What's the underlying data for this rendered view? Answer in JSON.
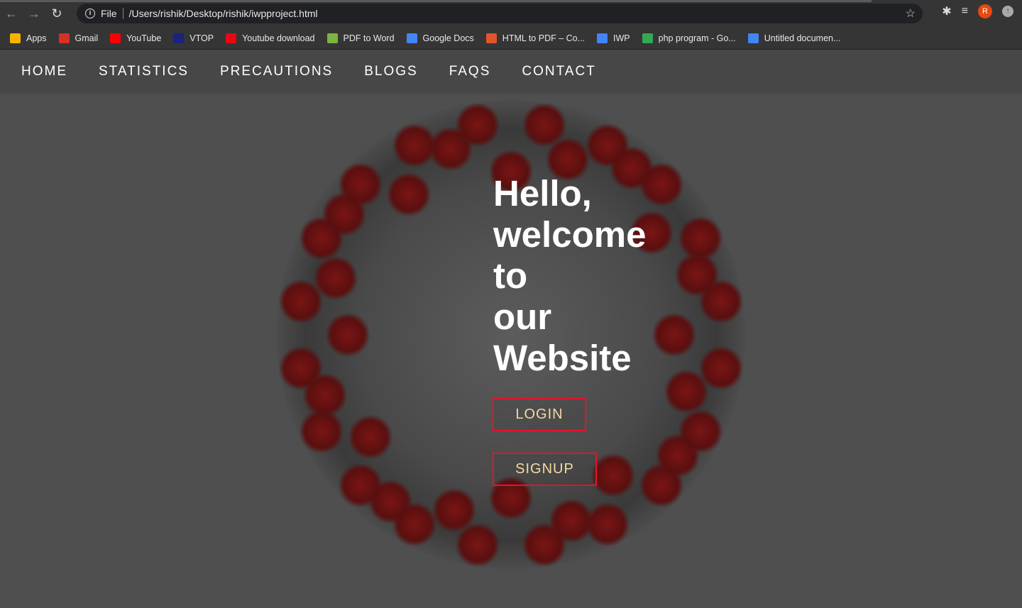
{
  "browser": {
    "url_scheme": "File",
    "url": "/Users/rishik/Desktop/rishik/iwpproject.html",
    "profile_initial": "R",
    "bookmarks": [
      {
        "label": "Apps",
        "color": "#f4b400"
      },
      {
        "label": "Gmail",
        "color": "#d93025"
      },
      {
        "label": "YouTube",
        "color": "#ff0000"
      },
      {
        "label": "VTOP",
        "color": "#1a237e"
      },
      {
        "label": "Youtube download",
        "color": "#e50914"
      },
      {
        "label": "PDF to Word",
        "color": "#7cb342"
      },
      {
        "label": "Google Docs",
        "color": "#4285f4"
      },
      {
        "label": "HTML to PDF – Co...",
        "color": "#e2542d"
      },
      {
        "label": "IWP",
        "color": "#4285f4"
      },
      {
        "label": "php program - Go...",
        "color": "#34a853"
      },
      {
        "label": "Untitled documen...",
        "color": "#4285f4"
      }
    ]
  },
  "nav": {
    "items": [
      "HOME",
      "STATISTICS",
      "PRECAUTIONS",
      "BLOGS",
      "FAQS",
      "CONTACT"
    ]
  },
  "hero": {
    "lines": [
      "Hello,",
      "welcome",
      "to",
      "our",
      "Website"
    ],
    "login": "LOGIN",
    "signup": "SIGNUP",
    "accent": "#e8112d"
  }
}
